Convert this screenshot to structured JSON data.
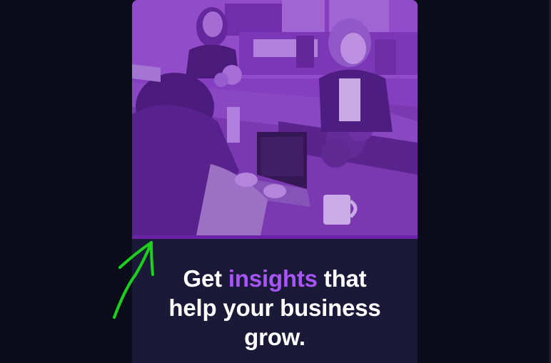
{
  "hero": {
    "image_description_icon": "team-office-photo-icon",
    "tint_color": "#8b3fc6",
    "accent_bar_color": "#6b21a8"
  },
  "headline": {
    "line1_prefix": "Get ",
    "line1_highlight": "insights",
    "line1_suffix": " that",
    "line2": "help your business",
    "line3": "grow.",
    "highlight_color": "#a855f7"
  },
  "annotation": {
    "icon": "arrow-up-icon",
    "color": "#1bd11b"
  }
}
